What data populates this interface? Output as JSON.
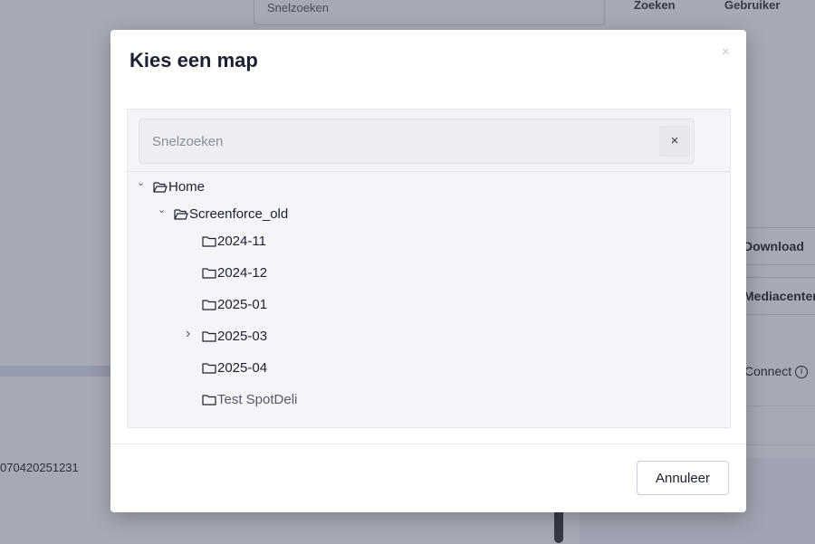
{
  "background": {
    "search_text": "Snelzoeken",
    "top_buttons": [
      "Zoeken",
      "Gebruiker"
    ],
    "right_buttons": [
      "Download",
      "Mediacenter"
    ],
    "right_text": "Connect",
    "left_id": "070420251231"
  },
  "dialog": {
    "title": "Kies een map",
    "close_icon": "×",
    "search": {
      "placeholder": "Snelzoeken",
      "value": "",
      "clear_icon": "×"
    },
    "tree": [
      {
        "label": "Home",
        "depth": 0,
        "expanded": true,
        "has_children": true,
        "open_folder": true
      },
      {
        "label": "Screenforce_old",
        "depth": 1,
        "expanded": true,
        "has_children": true,
        "open_folder": true
      },
      {
        "label": "2024-11",
        "depth": 2,
        "expanded": false,
        "has_children": false
      },
      {
        "label": "2024-12",
        "depth": 2,
        "expanded": false,
        "has_children": false
      },
      {
        "label": "2025-01",
        "depth": 2,
        "expanded": false,
        "has_children": false
      },
      {
        "label": "2025-03",
        "depth": 2,
        "expanded": false,
        "has_children": true
      },
      {
        "label": "2025-04",
        "depth": 2,
        "expanded": false,
        "has_children": false
      },
      {
        "label": "Test SpotDeli",
        "depth": 2,
        "expanded": false,
        "has_children": false
      }
    ],
    "cancel_label": "Annuleer"
  },
  "colors": {
    "overlay": "#3c405a",
    "title": "#1d2030",
    "tree_bg": "#f4f5f9",
    "search_bg": "#eceef3"
  }
}
